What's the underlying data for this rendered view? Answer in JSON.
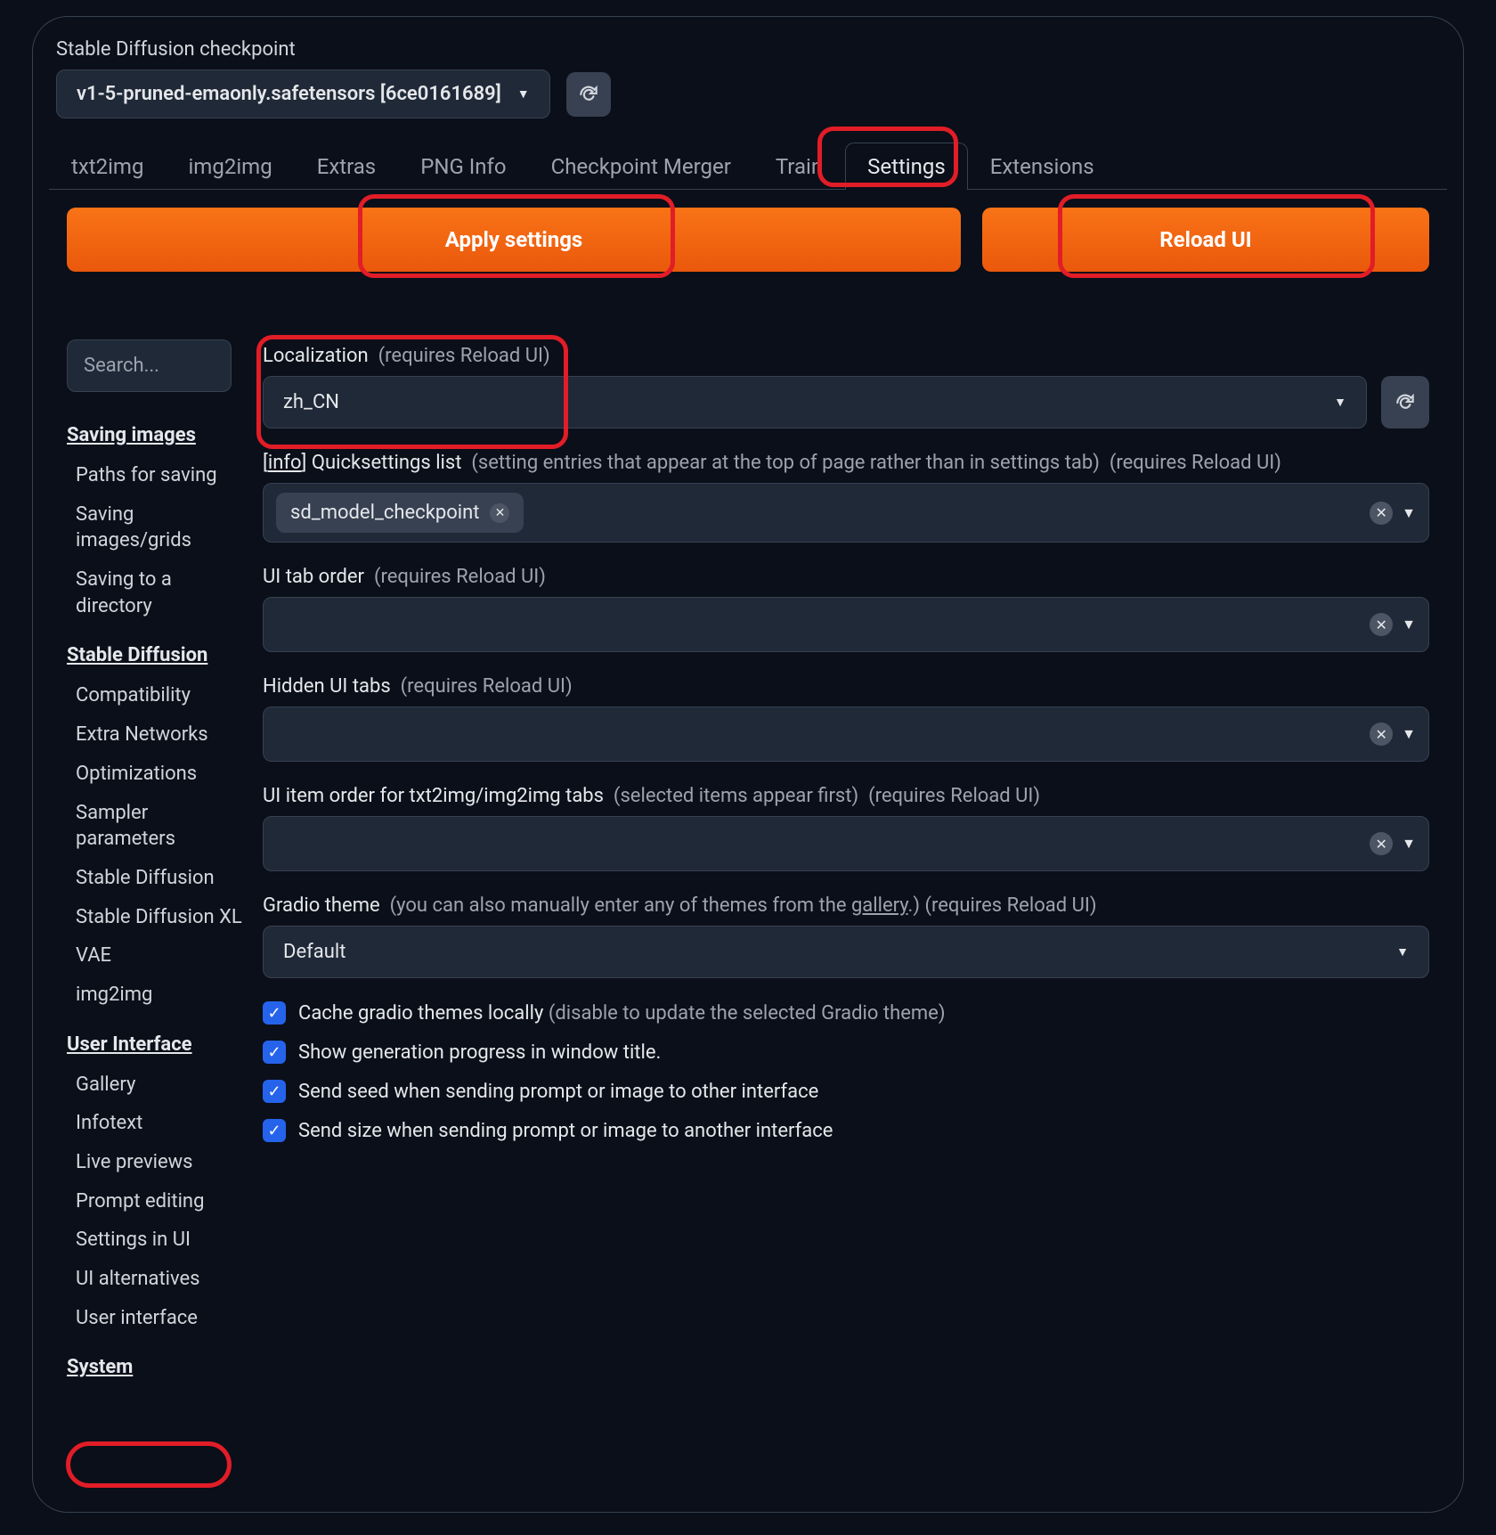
{
  "checkpoint": {
    "label": "Stable Diffusion checkpoint",
    "value": "v1-5-pruned-emaonly.safetensors [6ce0161689]"
  },
  "tabs": [
    "txt2img",
    "img2img",
    "Extras",
    "PNG Info",
    "Checkpoint Merger",
    "Train",
    "Settings",
    "Extensions"
  ],
  "active_tab": "Settings",
  "buttons": {
    "apply": "Apply settings",
    "reload": "Reload UI"
  },
  "search_placeholder": "Search...",
  "sidebar": {
    "groups": [
      {
        "heading": "Saving images",
        "items": [
          "Paths for saving",
          "Saving images/grids",
          "Saving to a directory"
        ]
      },
      {
        "heading": "Stable Diffusion",
        "items": [
          "Compatibility",
          "Extra Networks",
          "Optimizations",
          "Sampler parameters",
          "Stable Diffusion",
          "Stable Diffusion XL",
          "VAE",
          "img2img"
        ]
      },
      {
        "heading": "User Interface",
        "items": [
          "Gallery",
          "Infotext",
          "Live previews",
          "Prompt editing",
          "Settings in UI",
          "UI alternatives",
          "User interface"
        ]
      },
      {
        "heading": "System",
        "items": []
      }
    ]
  },
  "settings": {
    "localization": {
      "label": "Localization",
      "hint": "(requires Reload UI)",
      "value": "zh_CN"
    },
    "quicksettings": {
      "prefix": "[",
      "info": "info",
      "suffix": "] Quicksettings list",
      "hint1": "(setting entries that appear at the top of page rather than in settings tab)",
      "hint2": "(requires Reload UI)",
      "tags": [
        "sd_model_checkpoint"
      ]
    },
    "taborder": {
      "label": "UI tab order",
      "hint": "(requires Reload UI)"
    },
    "hidden": {
      "label": "Hidden UI tabs",
      "hint": "(requires Reload UI)"
    },
    "itemorder": {
      "label": "UI item order for txt2img/img2img tabs",
      "hint1": "(selected items appear first)",
      "hint2": "(requires Reload UI)"
    },
    "theme": {
      "label": "Gradio theme",
      "hint1": "(you can also manually enter any of themes from the ",
      "gallery": "gallery",
      "hint2": ".) (requires Reload UI)",
      "value": "Default"
    },
    "checks": [
      {
        "label": "Cache gradio themes locally",
        "hint": "(disable to update the selected Gradio theme)",
        "checked": true
      },
      {
        "label": "Show generation progress in window title.",
        "hint": "",
        "checked": true
      },
      {
        "label": "Send seed when sending prompt or image to other interface",
        "hint": "",
        "checked": true
      },
      {
        "label": "Send size when sending prompt or image to another interface",
        "hint": "",
        "checked": true
      }
    ]
  }
}
